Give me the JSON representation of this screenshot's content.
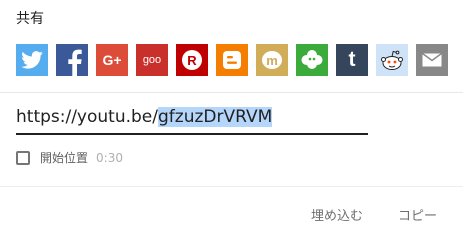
{
  "dialog": {
    "title": "共有",
    "share_targets": [
      {
        "name": "Twitter",
        "icon": "twitter-icon",
        "color": "#55acee"
      },
      {
        "name": "Facebook",
        "icon": "facebook-icon",
        "color": "#3b5998"
      },
      {
        "name": "Google+",
        "icon": "google-plus-icon",
        "color": "#dd4b39",
        "text": "G+"
      },
      {
        "name": "goo",
        "icon": "goo-icon",
        "color": "#c9302c",
        "text": "goo"
      },
      {
        "name": "Rakuten",
        "icon": "rakuten-icon",
        "color": "#bf0000",
        "text": "R"
      },
      {
        "name": "Blogger",
        "icon": "blogger-icon",
        "color": "#f57d00"
      },
      {
        "name": "mixi",
        "icon": "mixi-icon",
        "color": "#d1ad59",
        "text": "m"
      },
      {
        "name": "Ameba",
        "icon": "ameba-icon",
        "color": "#3bab3c"
      },
      {
        "name": "Tumblr",
        "icon": "tumblr-icon",
        "color": "#35465c",
        "text": "t"
      },
      {
        "name": "Reddit",
        "icon": "reddit-icon",
        "color": "#cee3f8"
      },
      {
        "name": "Email",
        "icon": "email-icon",
        "color": "#888888"
      }
    ],
    "url": {
      "prefix": "https://youtu.be/",
      "selected": "gfzuzDrVRVM"
    },
    "start_at": {
      "label": "開始位置",
      "time": "0:30",
      "checked": false
    },
    "buttons": {
      "embed": "埋め込む",
      "copy": "コピー"
    }
  }
}
